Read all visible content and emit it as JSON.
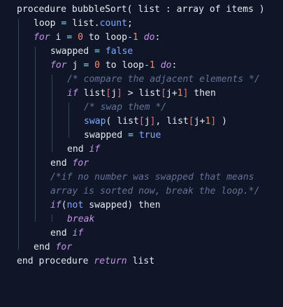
{
  "code": {
    "lines": [
      "procedure bubbleSort( list : array of items )",
      "loop = list.count;",
      "for i = 0 to loop-1 do:",
      "swapped = false",
      "for j = 0 to loop-1 do:",
      "/* compare the adjacent elements */",
      "if list[j] > list[j+1] then",
      "/* swap them */",
      "swap( list[j], list[j+1] )",
      "swapped = true",
      "end if",
      "end for",
      "/*if no number was swapped that means",
      "array is sorted now, break the loop.*/",
      "if(not swapped) then",
      "break",
      "end if",
      "end for",
      "end procedure return list"
    ]
  },
  "colors": {
    "background": "#0f1628",
    "keyword": "#c792ea",
    "number": "#f78c6c",
    "operator": "#89ddff",
    "function": "#82aaff",
    "comment": "#697098",
    "text": "#e6e9ef",
    "indent_guide": "#3a4258"
  }
}
